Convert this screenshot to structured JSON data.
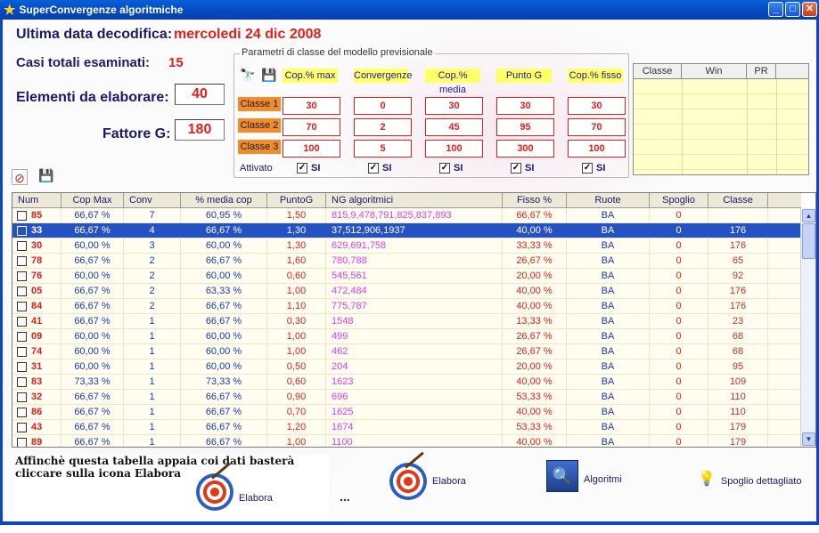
{
  "window": {
    "title": "SuperConvergenze algoritmiche"
  },
  "header": {
    "ultima_label": "Ultima data decodifica:",
    "ultima_value": "mercoledi 24 dic 2008",
    "casi_label": "Casi totali esaminati:",
    "casi_value": "15",
    "elementi_label": "Elementi da elaborare:",
    "elementi_value": "40",
    "fattore_label": "Fattore G:",
    "fattore_value": "180"
  },
  "params": {
    "title": "Parametri di classe del modello previsionale",
    "columns": [
      "Cop.% max",
      "Convergenze",
      "Cop.% media",
      "Punto G",
      "Cop.% fisso"
    ],
    "rows": [
      {
        "label": "Classe 1",
        "values": [
          "30",
          "0",
          "30",
          "30",
          "30"
        ]
      },
      {
        "label": "Classe 2",
        "values": [
          "70",
          "2",
          "45",
          "95",
          "70"
        ]
      },
      {
        "label": "Classe 3",
        "values": [
          "100",
          "5",
          "100",
          "300",
          "100"
        ]
      }
    ],
    "attivato_label": "Attivato",
    "check_label": "SI"
  },
  "cwp_table": {
    "headers": [
      "Classe",
      "Win",
      "PR"
    ]
  },
  "grid": {
    "headers": [
      "Num",
      "Cop Max",
      "Conv",
      "% media cop",
      "PuntoG",
      "NG algoritmici",
      "Fisso %",
      "Ruote",
      "Spoglio",
      "Classe"
    ],
    "rows": [
      [
        "85",
        "66,67 %",
        "7",
        "60,95 %",
        "1,50",
        "815,9,478,791,825,837,893",
        "66,67 %",
        "BA",
        "0",
        ""
      ],
      [
        "33",
        "66,67 %",
        "4",
        "66,67 %",
        "1,30",
        "37,512,906,1937",
        "40,00 %",
        "BA",
        "0",
        "176"
      ],
      [
        "30",
        "60,00 %",
        "3",
        "60,00 %",
        "1,30",
        "629,691,758",
        "33,33 %",
        "BA",
        "0",
        "176"
      ],
      [
        "78",
        "66,67 %",
        "2",
        "66,67 %",
        "1,60",
        "780,788",
        "26,67 %",
        "BA",
        "0",
        "65"
      ],
      [
        "76",
        "60,00 %",
        "2",
        "60,00 %",
        "0,60",
        "545,561",
        "20,00 %",
        "BA",
        "0",
        "92"
      ],
      [
        "05",
        "66,67 %",
        "2",
        "63,33 %",
        "1,00",
        "472,484",
        "40,00 %",
        "BA",
        "0",
        "176"
      ],
      [
        "84",
        "66,67 %",
        "2",
        "66,67 %",
        "1,10",
        "775,787",
        "40,00 %",
        "BA",
        "0",
        "176"
      ],
      [
        "41",
        "66,67 %",
        "1",
        "66,67 %",
        "0,30",
        "1548",
        "13,33 %",
        "BA",
        "0",
        "23"
      ],
      [
        "09",
        "60,00 %",
        "1",
        "60,00 %",
        "1,00",
        "499",
        "26,67 %",
        "BA",
        "0",
        "68"
      ],
      [
        "74",
        "60,00 %",
        "1",
        "60,00 %",
        "1,00",
        "462",
        "26,67 %",
        "BA",
        "0",
        "68"
      ],
      [
        "31",
        "60,00 %",
        "1",
        "60,00 %",
        "0,50",
        "204",
        "20,00 %",
        "BA",
        "0",
        "95"
      ],
      [
        "83",
        "73,33 %",
        "1",
        "73,33 %",
        "0,60",
        "1623",
        "40,00 %",
        "BA",
        "0",
        "109"
      ],
      [
        "32",
        "66,67 %",
        "1",
        "66,67 %",
        "0,90",
        "696",
        "53,33 %",
        "BA",
        "0",
        "110"
      ],
      [
        "86",
        "66,67 %",
        "1",
        "66,67 %",
        "0,70",
        "1625",
        "40,00 %",
        "BA",
        "0",
        "110"
      ],
      [
        "43",
        "66,67 %",
        "1",
        "66,67 %",
        "1,20",
        "1674",
        "53,33 %",
        "BA",
        "0",
        "179"
      ],
      [
        "89",
        "66,67 %",
        "1",
        "66,67 %",
        "1,00",
        "1100",
        "40,00 %",
        "BA",
        "0",
        "179"
      ]
    ],
    "selected_row": 1
  },
  "bottom": {
    "note_line1": "Affinchè questa tabella appaia coi dati basterà",
    "note_line2": "cliccare sulla icona Elabora",
    "elabora1": "Elabora",
    "dots": "...",
    "elabora2": "Elabora",
    "algoritmi": "Algoritmi",
    "spoglio": "Spoglio dettagliato"
  },
  "colors": {
    "titlebar": "#0348c1",
    "accent_red": "#e0201c",
    "selection": "#2451c4",
    "header_yellow": "#ffff66",
    "classe_orange": "#f28c28"
  }
}
